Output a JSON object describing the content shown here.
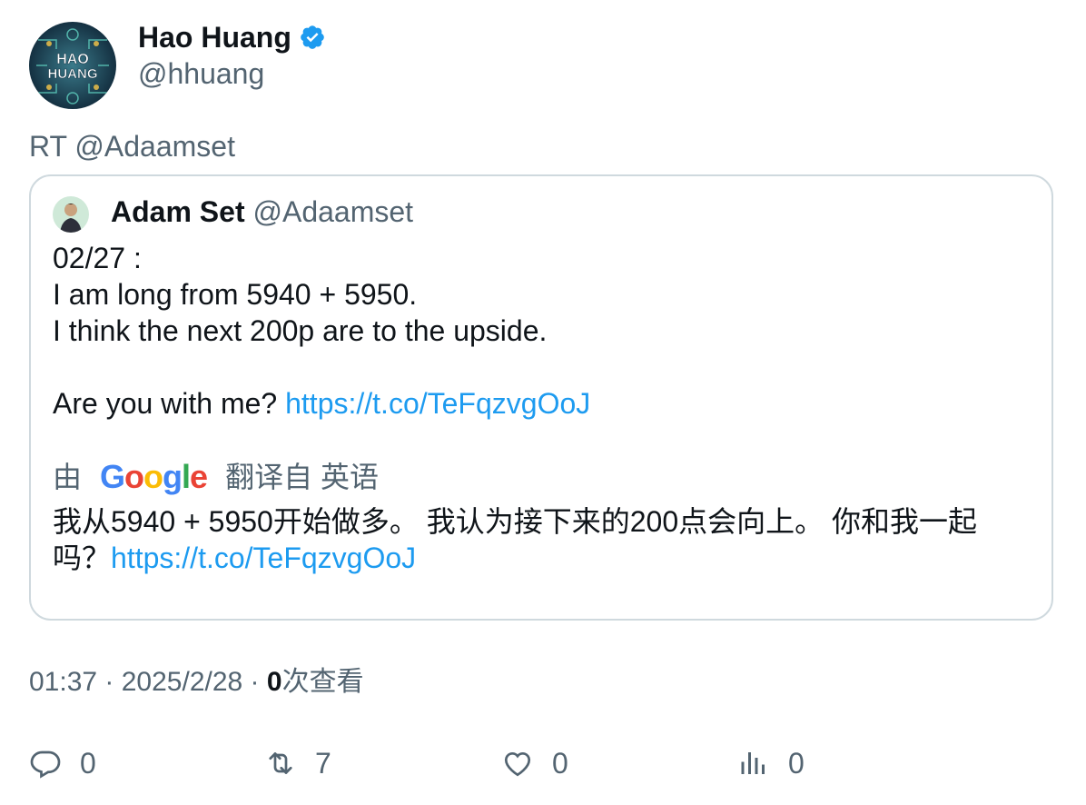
{
  "author": {
    "name": "Hao Huang",
    "handle": "@hhuang",
    "avatar_text_line1": "HAO",
    "avatar_text_line2": "HUANG",
    "verified_icon": "verified-badge-icon"
  },
  "retweet_text": "RT @Adaamset",
  "quoted": {
    "name": "Adam Set",
    "handle": "@Adaamset",
    "lines": [
      "02/27 :",
      "I am long from 5940 + 5950.",
      "I think the next 200p are to the upside.",
      ""
    ],
    "last_line_prefix": "Are you with me? ",
    "link": "https://t.co/TeFqzvgOoJ"
  },
  "translation": {
    "prefix": "由",
    "brand": "Google",
    "suffix": "翻译自 英语",
    "text_line1": "我从5940 + 5950开始做多。 我认为接下来的200点会向上。 你和我一起",
    "text_line2_prefix": "吗？",
    "link": "https://t.co/TeFqzvgOoJ"
  },
  "meta": {
    "time": "01:37",
    "sep1": " · ",
    "date": "2025/2/28",
    "sep2": " · ",
    "views_count": "0",
    "views_label": "次查看"
  },
  "actions": {
    "reply_count": "0",
    "retweet_count": "7",
    "like_count": "0",
    "views_count": "0"
  },
  "colors": {
    "accent": "#1d9bf0",
    "text_secondary": "#536471",
    "border": "#cfd9de"
  }
}
